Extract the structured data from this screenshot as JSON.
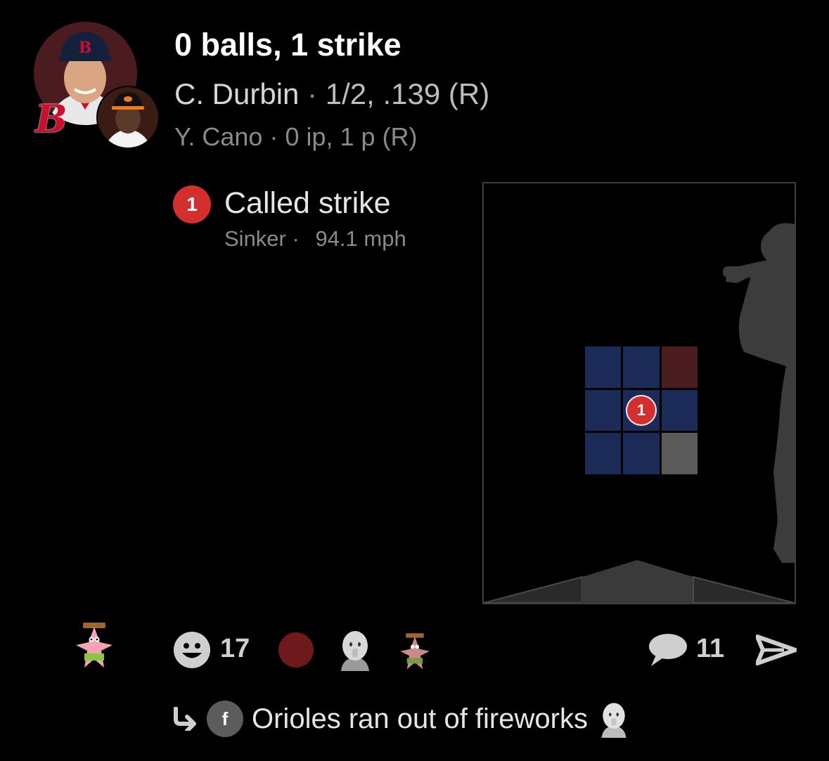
{
  "header": {
    "title": "0 balls, 1 strike",
    "batter_name": "C. Durbin",
    "batter_stats": "1/2, .139 (R)",
    "pitcher_name": "Y. Cano",
    "pitcher_stats": "0 ip, 1 p (R)",
    "separator": "·",
    "team_logo": "B",
    "team_color": "#c8102e"
  },
  "pitch": {
    "number": "1",
    "result": "Called strike",
    "type": "Sinker",
    "detail_separator": "·",
    "speed": "94.1 mph",
    "badge_color": "#d32f2f"
  },
  "strike_zone": {
    "cells": [
      {
        "color": "#1b2a56"
      },
      {
        "color": "#1b2a56"
      },
      {
        "color": "#4a1c1f"
      },
      {
        "color": "#1b2a56"
      },
      {
        "color": "#1b2a56"
      },
      {
        "color": "#1b2a56"
      },
      {
        "color": "#1b2a56"
      },
      {
        "color": "#1b2a56"
      },
      {
        "color": "#5a5a5a"
      }
    ],
    "pitch_cell": 4,
    "pitch_label": "1"
  },
  "reactions": {
    "emoji_count": "17",
    "comment_count": "11",
    "reaction_dot_color": "#6e1a1d",
    "icons": [
      "patrick-star-sticker-icon",
      "smiley-icon",
      "red-circle-icon",
      "baby-face-sticker-icon",
      "patrick-star-sticker-icon",
      "comment-icon",
      "send-icon"
    ]
  },
  "reply": {
    "avatar_letter": "f",
    "text": "Orioles ran out of fireworks",
    "icons": [
      "reply-arrow-icon",
      "baby-face-sticker-icon"
    ]
  }
}
